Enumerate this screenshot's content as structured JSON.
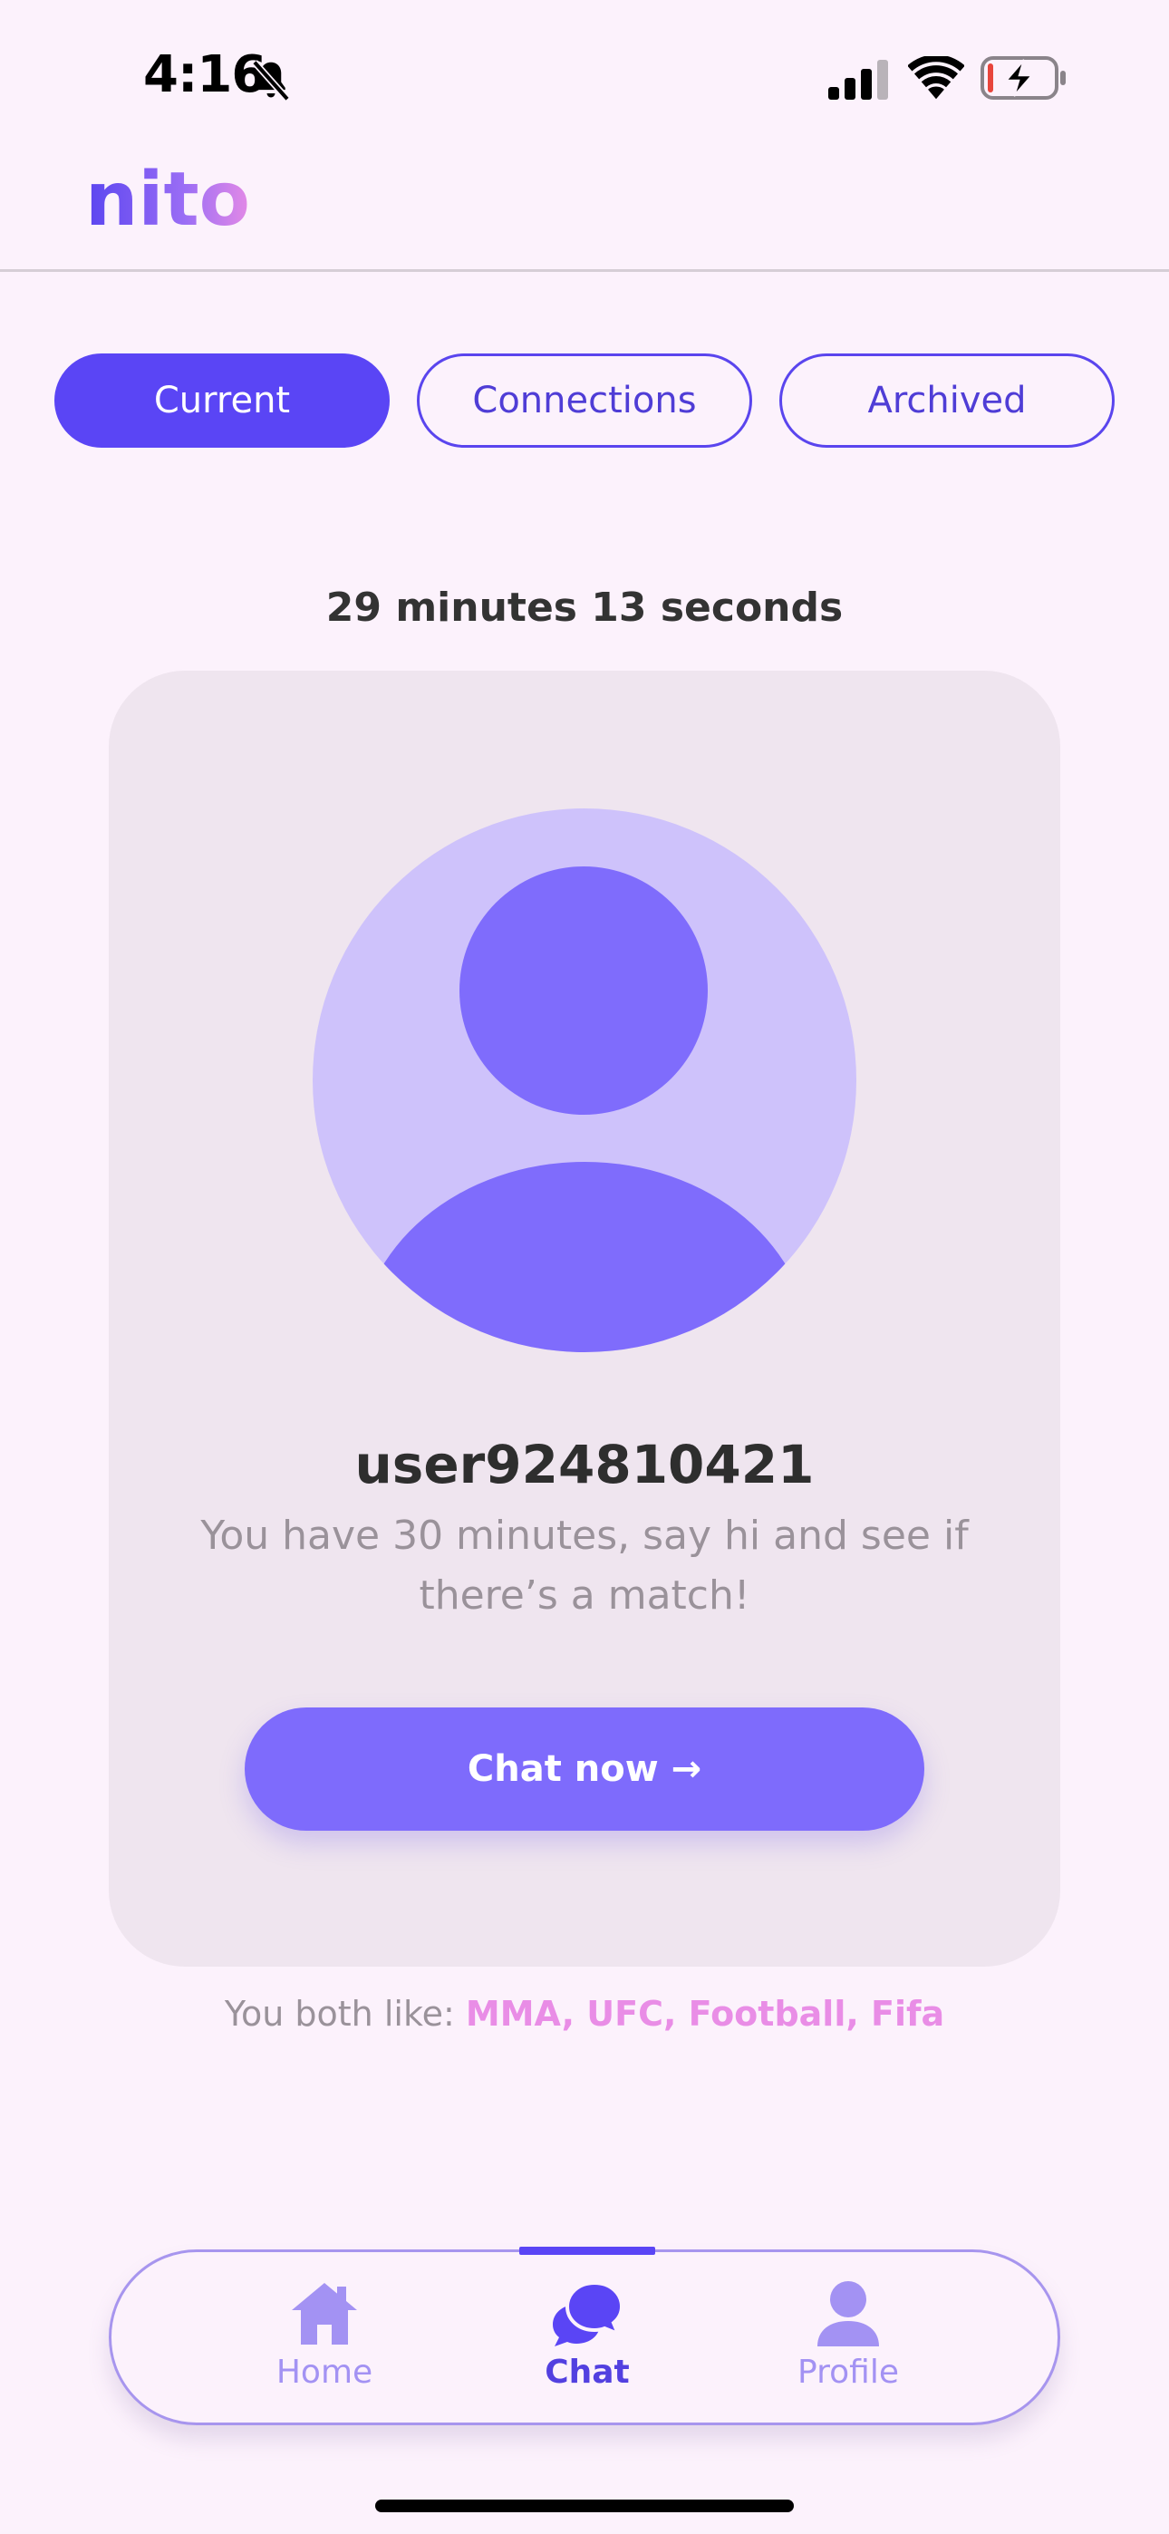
{
  "status_bar": {
    "time": "4:16",
    "icons": [
      "bell-slash-icon",
      "cellular-signal-icon",
      "wifi-icon",
      "battery-charging-icon"
    ]
  },
  "header": {
    "logo_text": "nito"
  },
  "tabs": [
    {
      "label": "Current",
      "active": true
    },
    {
      "label": "Connections",
      "active": false
    },
    {
      "label": "Archived",
      "active": false
    }
  ],
  "timer": "29 minutes 13 seconds",
  "match_card": {
    "username": "user924810421",
    "hint": "You have 30 minutes, say hi and see if there’s a match!",
    "chat_button_label": "Chat now →"
  },
  "shared_interests": {
    "prefix": "You both like: ",
    "interests": "MMA, UFC, Football, Fifa"
  },
  "bottom_nav": {
    "items": [
      {
        "label": "Home",
        "icon": "home-icon",
        "active": false
      },
      {
        "label": "Chat",
        "icon": "chat-bubbles-icon",
        "active": true
      },
      {
        "label": "Profile",
        "icon": "person-icon",
        "active": false
      }
    ]
  },
  "colors": {
    "background": "#fcf2fc",
    "accent": "#5a45f5",
    "button": "#7e6bfc",
    "card": "#efe5ef",
    "interest_pink": "#e98de6"
  }
}
